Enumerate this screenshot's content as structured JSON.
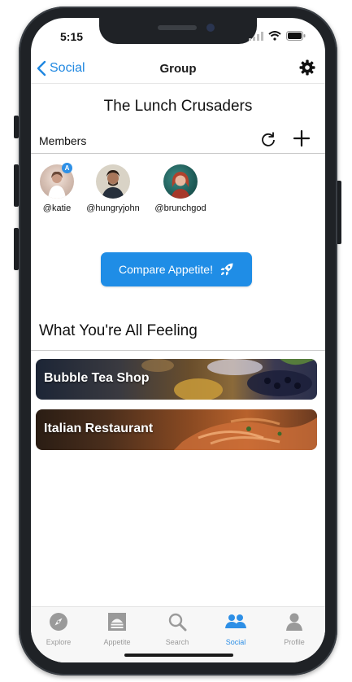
{
  "status": {
    "time": "5:15"
  },
  "nav": {
    "back_label": "Social",
    "title": "Group"
  },
  "group": {
    "name": "The Lunch Crusaders"
  },
  "members": {
    "label": "Members",
    "list": [
      {
        "handle": "@katie",
        "badge": "A"
      },
      {
        "handle": "@hungryjohn"
      },
      {
        "handle": "@brunchgod"
      }
    ]
  },
  "compare": {
    "label": "Compare Appetite!"
  },
  "feelings": {
    "title": "What You're All Feeling",
    "items": [
      {
        "label": "Bubble Tea Shop"
      },
      {
        "label": "Italian Restaurant"
      }
    ]
  },
  "tabs": [
    {
      "label": "Explore",
      "icon": "compass-icon"
    },
    {
      "label": "Appetite",
      "icon": "appetite-icon"
    },
    {
      "label": "Search",
      "icon": "search-icon"
    },
    {
      "label": "Social",
      "icon": "people-icon",
      "active": true
    },
    {
      "label": "Profile",
      "icon": "person-icon"
    }
  ],
  "colors": {
    "accent": "#1f8de6",
    "tab_active": "#2d8fe6",
    "tab_inactive": "#9a9a9a"
  }
}
